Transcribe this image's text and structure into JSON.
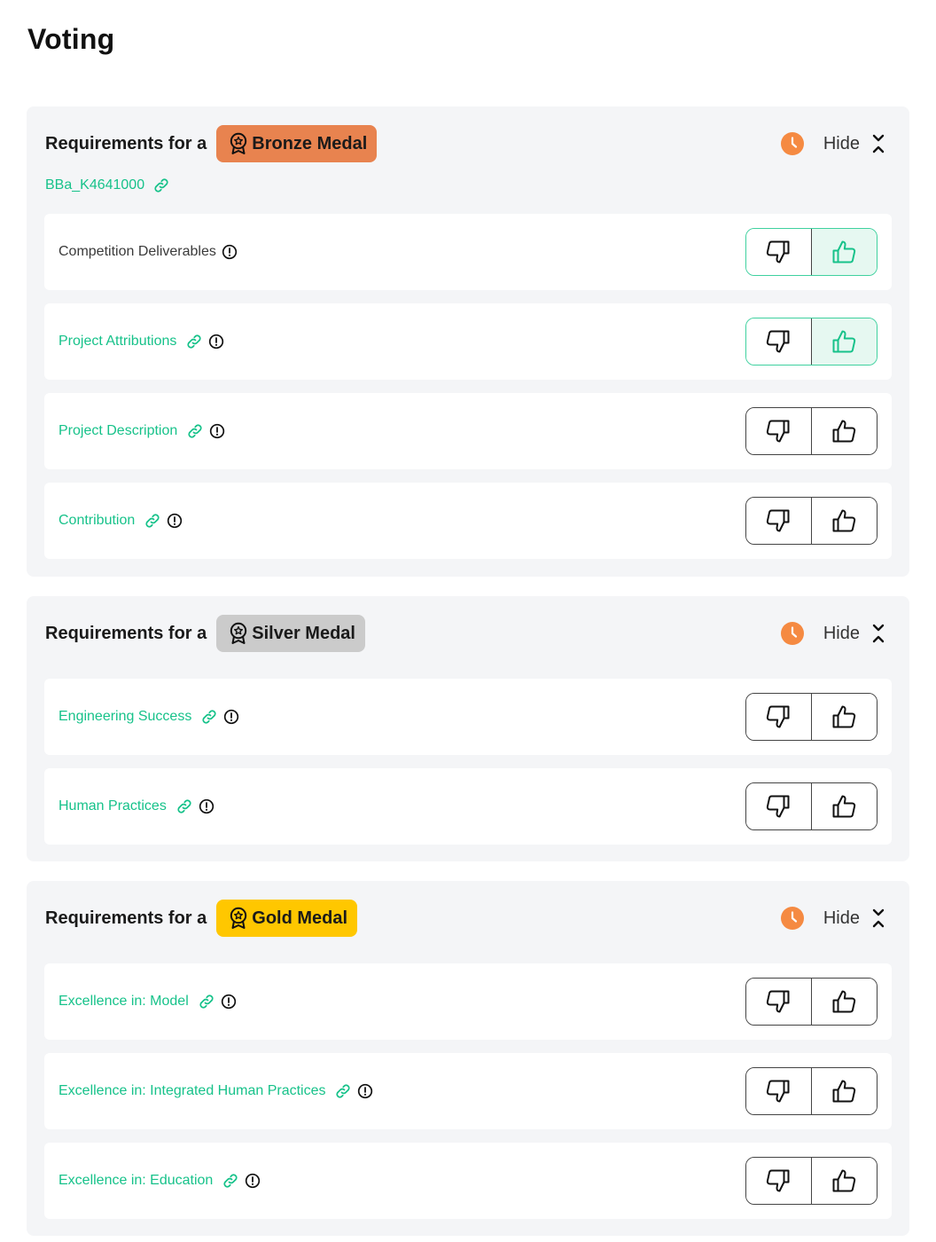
{
  "page": {
    "title": "Voting"
  },
  "colors": {
    "accent": "#17c28a",
    "bronze": "#e8834f",
    "silver": "#cbcbcb",
    "gold": "#ffc700",
    "clock": "#f58a42"
  },
  "sections": [
    {
      "requirements_label": "Requirements for a",
      "medal": "Bronze Medal",
      "hide_label": "Hide",
      "team_link": "BBa_K4641000",
      "rows": [
        {
          "label": "Competition Deliverables",
          "linked": false,
          "vote": "up"
        },
        {
          "label": "Project Attributions",
          "linked": true,
          "vote": "up"
        },
        {
          "label": "Project Description",
          "linked": true,
          "vote": "none"
        },
        {
          "label": "Contribution",
          "linked": true,
          "vote": "none"
        }
      ]
    },
    {
      "requirements_label": "Requirements for a",
      "medal": "Silver Medal",
      "hide_label": "Hide",
      "rows": [
        {
          "label": "Engineering Success",
          "linked": true,
          "vote": "none"
        },
        {
          "label": "Human Practices",
          "linked": true,
          "vote": "none"
        }
      ]
    },
    {
      "requirements_label": "Requirements for a",
      "medal": "Gold Medal",
      "hide_label": "Hide",
      "rows": [
        {
          "label": "Excellence in: Model",
          "linked": true,
          "vote": "none"
        },
        {
          "label": "Excellence in: Integrated Human Practices",
          "linked": true,
          "vote": "none"
        },
        {
          "label": "Excellence in: Education",
          "linked": true,
          "vote": "none"
        }
      ]
    }
  ]
}
